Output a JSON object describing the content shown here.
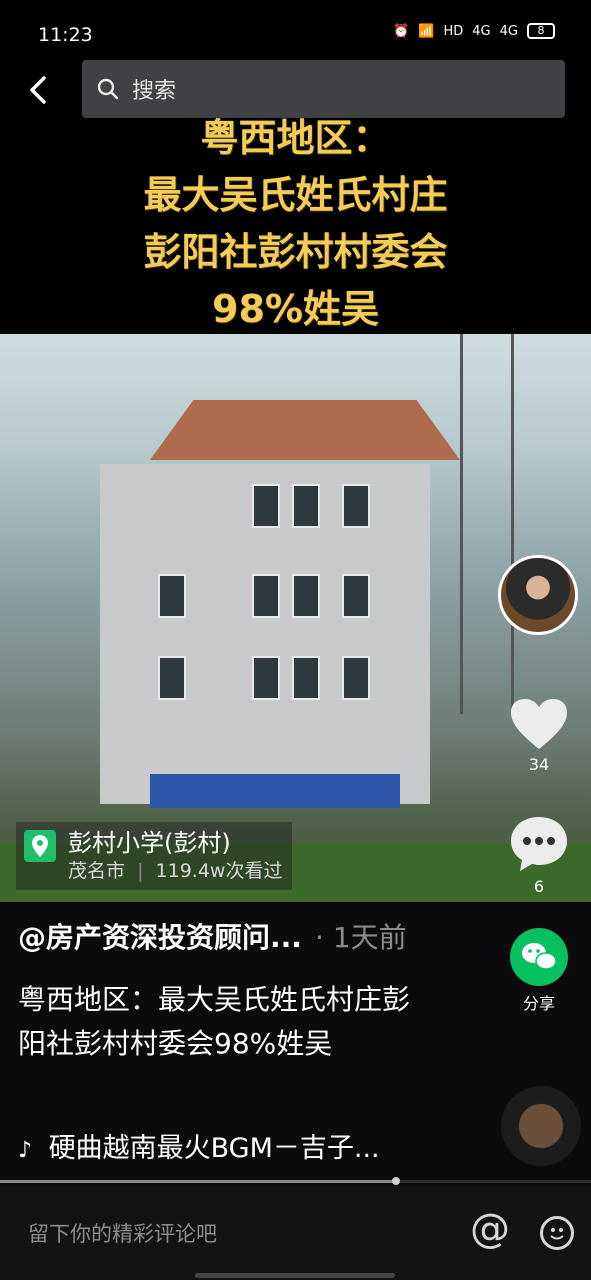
{
  "status_bar": {
    "time": "11:23",
    "network": "HD",
    "signal_1": "4G",
    "signal_2": "4G",
    "battery": "8"
  },
  "search": {
    "placeholder": "搜索"
  },
  "video": {
    "caption_lines": [
      "粤西地区：",
      "最大吴氏姓氏村庄",
      "彭阳社彭村村委会",
      "98%姓吴"
    ]
  },
  "location": {
    "name": "彭村小学(彭村)",
    "city": "茂名市",
    "views": "119.4w次看过"
  },
  "actions": {
    "likes": "34",
    "comments": "6",
    "share_label": "分享"
  },
  "post": {
    "author": "@房产资深投资顾问...",
    "time_ago": "· 1天前",
    "description": "粤西地区：最大吴氏姓氏村庄彭阳社彭村村委会98%姓吴"
  },
  "music": {
    "title": "硬曲越南最火BGM－吉子..."
  },
  "progress": {
    "fraction": 0.67
  },
  "comment_bar": {
    "placeholder": "留下你的精彩评论吧"
  },
  "colors": {
    "caption": "#f3cc55",
    "share_green": "#07c160",
    "location_green": "#1fbf6a"
  }
}
